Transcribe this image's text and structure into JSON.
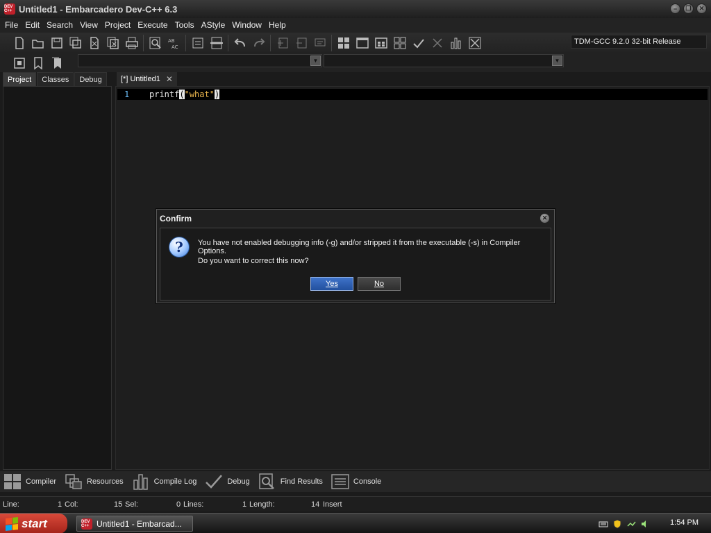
{
  "window": {
    "title": "Untitled1 - Embarcadero Dev-C++ 6.3",
    "logo_text": "DEV C++"
  },
  "menu": [
    "File",
    "Edit",
    "Search",
    "View",
    "Project",
    "Execute",
    "Tools",
    "AStyle",
    "Window",
    "Help"
  ],
  "toolbar": {
    "compiler": "TDM-GCC 9.2.0 32-bit Release"
  },
  "left_tabs": [
    "Project",
    "Classes",
    "Debug"
  ],
  "editor": {
    "tab_label": "[*] Untitled1",
    "line_number": "1",
    "code_ident": "printf",
    "code_open": "(",
    "code_string": "\"what\"",
    "code_close": ")"
  },
  "dialog": {
    "title": "Confirm",
    "message1": "You have not enabled debugging info (-g) and/or stripped it from the executable (-s) in Compiler Options.",
    "message2": "Do you want to correct this now?",
    "yes": "Yes",
    "no": "No"
  },
  "bottom_tabs": [
    "Compiler",
    "Resources",
    "Compile Log",
    "Debug",
    "Find Results",
    "Console"
  ],
  "status": {
    "line_label": "Line:",
    "line_value": "1",
    "col_label": "Col:",
    "col_value": "15",
    "sel_label": "Sel:",
    "sel_value": "0",
    "lines_label": "Lines:",
    "lines_value": "1",
    "length_label": "Length:",
    "length_value": "14",
    "mode": "Insert"
  },
  "taskbar": {
    "start": "start",
    "task": "Untitled1 - Embarcad...",
    "clock": "1:54 PM"
  },
  "colors": {
    "accent": "#3f73c9",
    "line_number": "#6fc3ff",
    "string": "#e9b44c"
  }
}
